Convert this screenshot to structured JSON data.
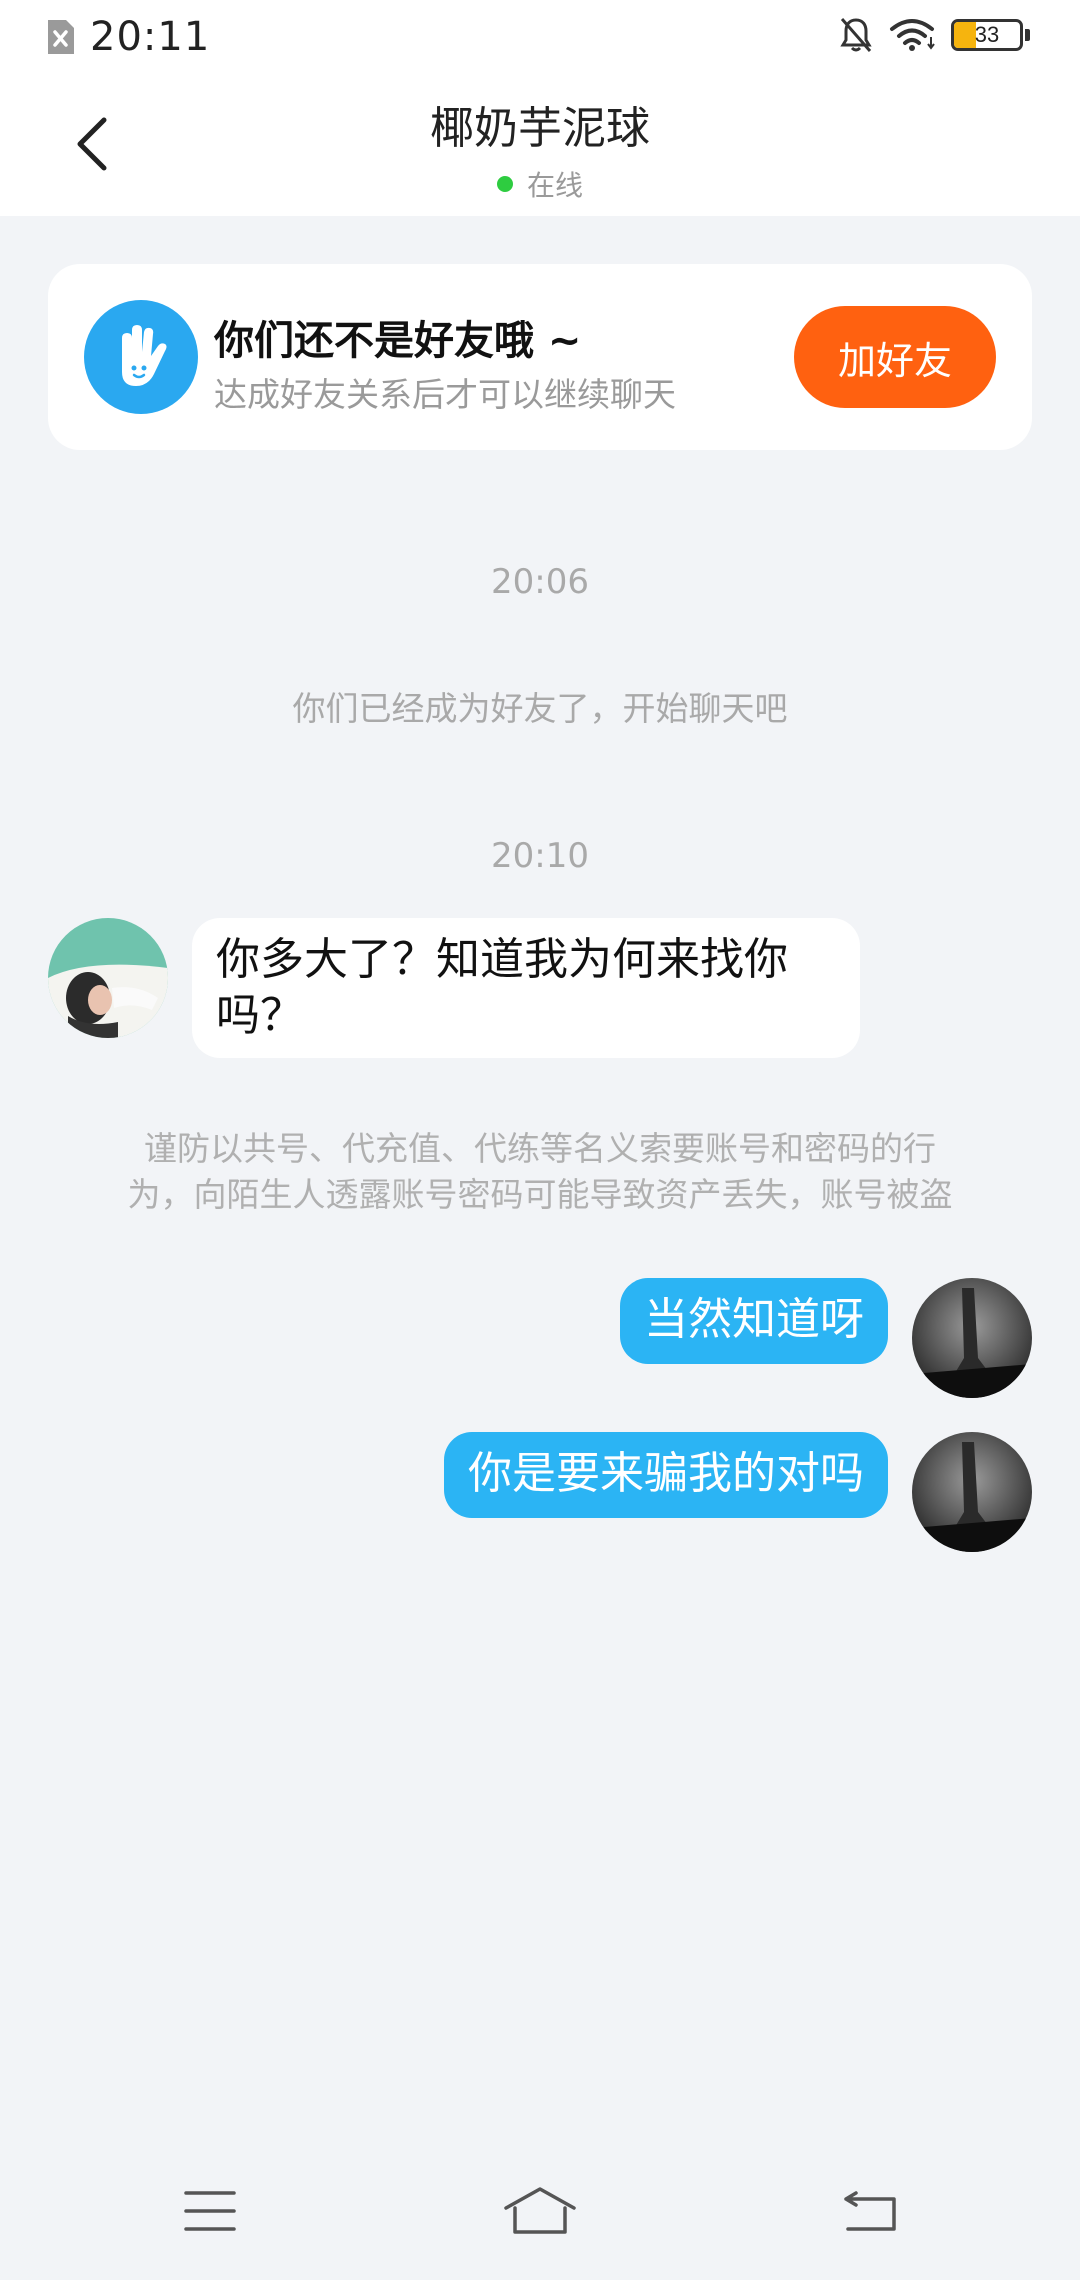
{
  "status_bar": {
    "time": "20:11",
    "battery_level": "33",
    "battery_fraction": 0.33,
    "icons": [
      "sim-error-icon",
      "bell-off-icon",
      "wifi-icon",
      "battery-icon"
    ]
  },
  "header": {
    "title": "椰奶芋泥球",
    "status": "在线",
    "status_color": "#2ecc40"
  },
  "friend_card": {
    "title": "你们还不是好友哦 ~",
    "subtitle": "达成好友关系后才可以继续聊天",
    "button_label": "加好友",
    "button_color": "#ff6110",
    "icon": "waving-hand-icon"
  },
  "messages": {
    "time_1": "20:06",
    "system_1": "你们已经成为好友了，开始聊天吧",
    "time_2": "20:10",
    "incoming_1_line_1": "你多大了？知道我为何来找你",
    "incoming_1_line_2": "吗？",
    "warning_line_1": "谨防以共号、代充值、代练等名义索要账号和密码的行",
    "warning_line_2": "为，向陌生人透露账号密码可能导致资产丢失，账号被盗",
    "outgoing_1": "当然知道呀",
    "outgoing_2": "你是要来骗我的对吗",
    "outgoing_color": "#2bb4f4"
  },
  "nav_bar": {
    "icons": [
      "menu-icon",
      "home-icon",
      "back-icon"
    ]
  }
}
